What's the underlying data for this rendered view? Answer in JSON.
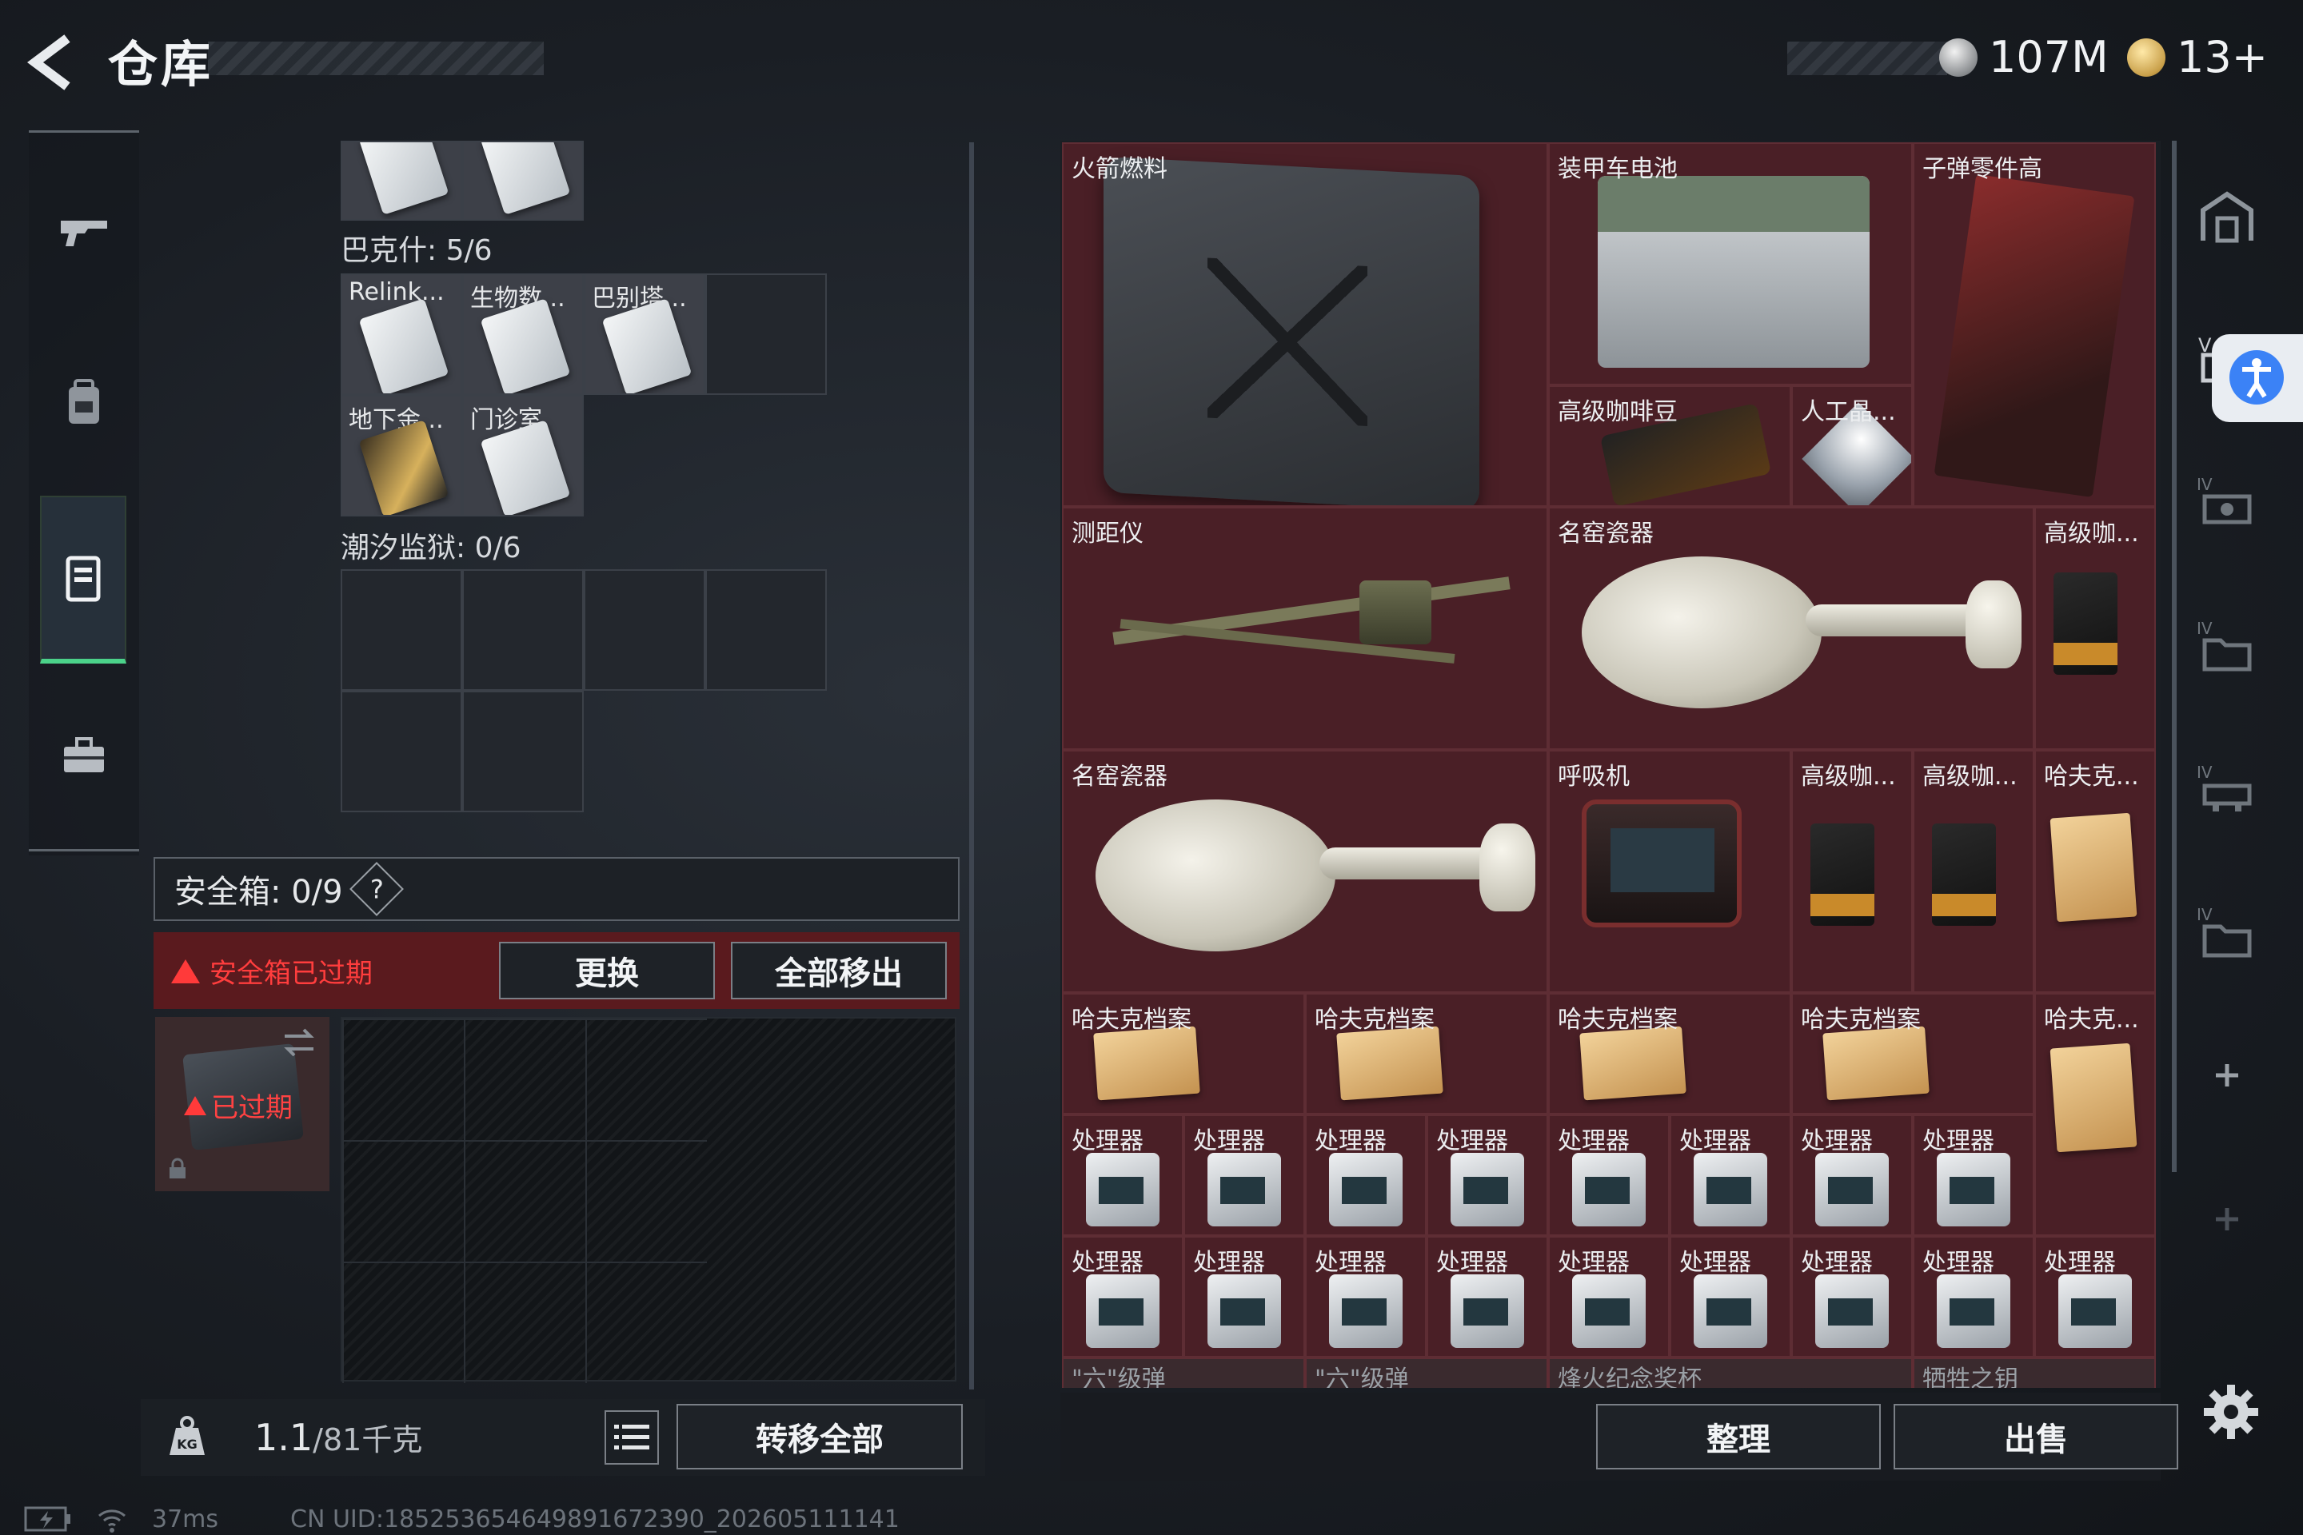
{
  "header": {
    "title": "仓库",
    "currency_primary": "107M",
    "currency_secondary": "13+"
  },
  "left_panel": {
    "group_bakesh": {
      "label": "巴克什: 5/6",
      "items": [
        "Relink...",
        "生物数...",
        "巴别塔...",
        "地下金...",
        "门诊室"
      ]
    },
    "group_tide_prison": {
      "label": "潮汐监狱: 0/6"
    },
    "safe_box": {
      "title": "安全箱: 0/9",
      "help": "?",
      "expired_warning": "安全箱已过期",
      "item_expired": "已过期",
      "replace_label": "更换",
      "remove_all_label": "全部移出"
    },
    "bottom": {
      "weight_current": "1.1",
      "weight_max": "/81千克",
      "transfer_all_label": "转移全部",
      "kg_badge": "KG"
    }
  },
  "warehouse": {
    "items": [
      {
        "label": "火箭燃料"
      },
      {
        "label": "装甲车电池"
      },
      {
        "label": "子弹零件高"
      },
      {
        "label": "高级咖啡豆"
      },
      {
        "label": "人工晶..."
      },
      {
        "label": "测距仪"
      },
      {
        "label": "名窑瓷器"
      },
      {
        "label": "高级咖..."
      },
      {
        "label": "名窑瓷器"
      },
      {
        "label": "呼吸机"
      },
      {
        "label": "高级咖..."
      },
      {
        "label": "高级咖..."
      },
      {
        "label": "哈夫克..."
      },
      {
        "label": "哈夫克档案"
      },
      {
        "label": "哈夫克档案"
      },
      {
        "label": "哈夫克档案"
      },
      {
        "label": "哈夫克档案"
      },
      {
        "label": "哈夫克..."
      }
    ],
    "processor_label": "处理器",
    "bottom_row": [
      "\"六\"级弹",
      "\"六\"级弹",
      "烽火纪念奖杯",
      "牺牲之钥"
    ],
    "organize_label": "整理",
    "sell_label": "出售"
  },
  "status_bar": {
    "ping": "37ms",
    "uid": "CN UID:185253654649891672390_202605111141"
  },
  "colors": {
    "accent_green": "#4bd28a",
    "warning_red": "#ff3d3d",
    "cell_maroon": "#4a1f26"
  }
}
